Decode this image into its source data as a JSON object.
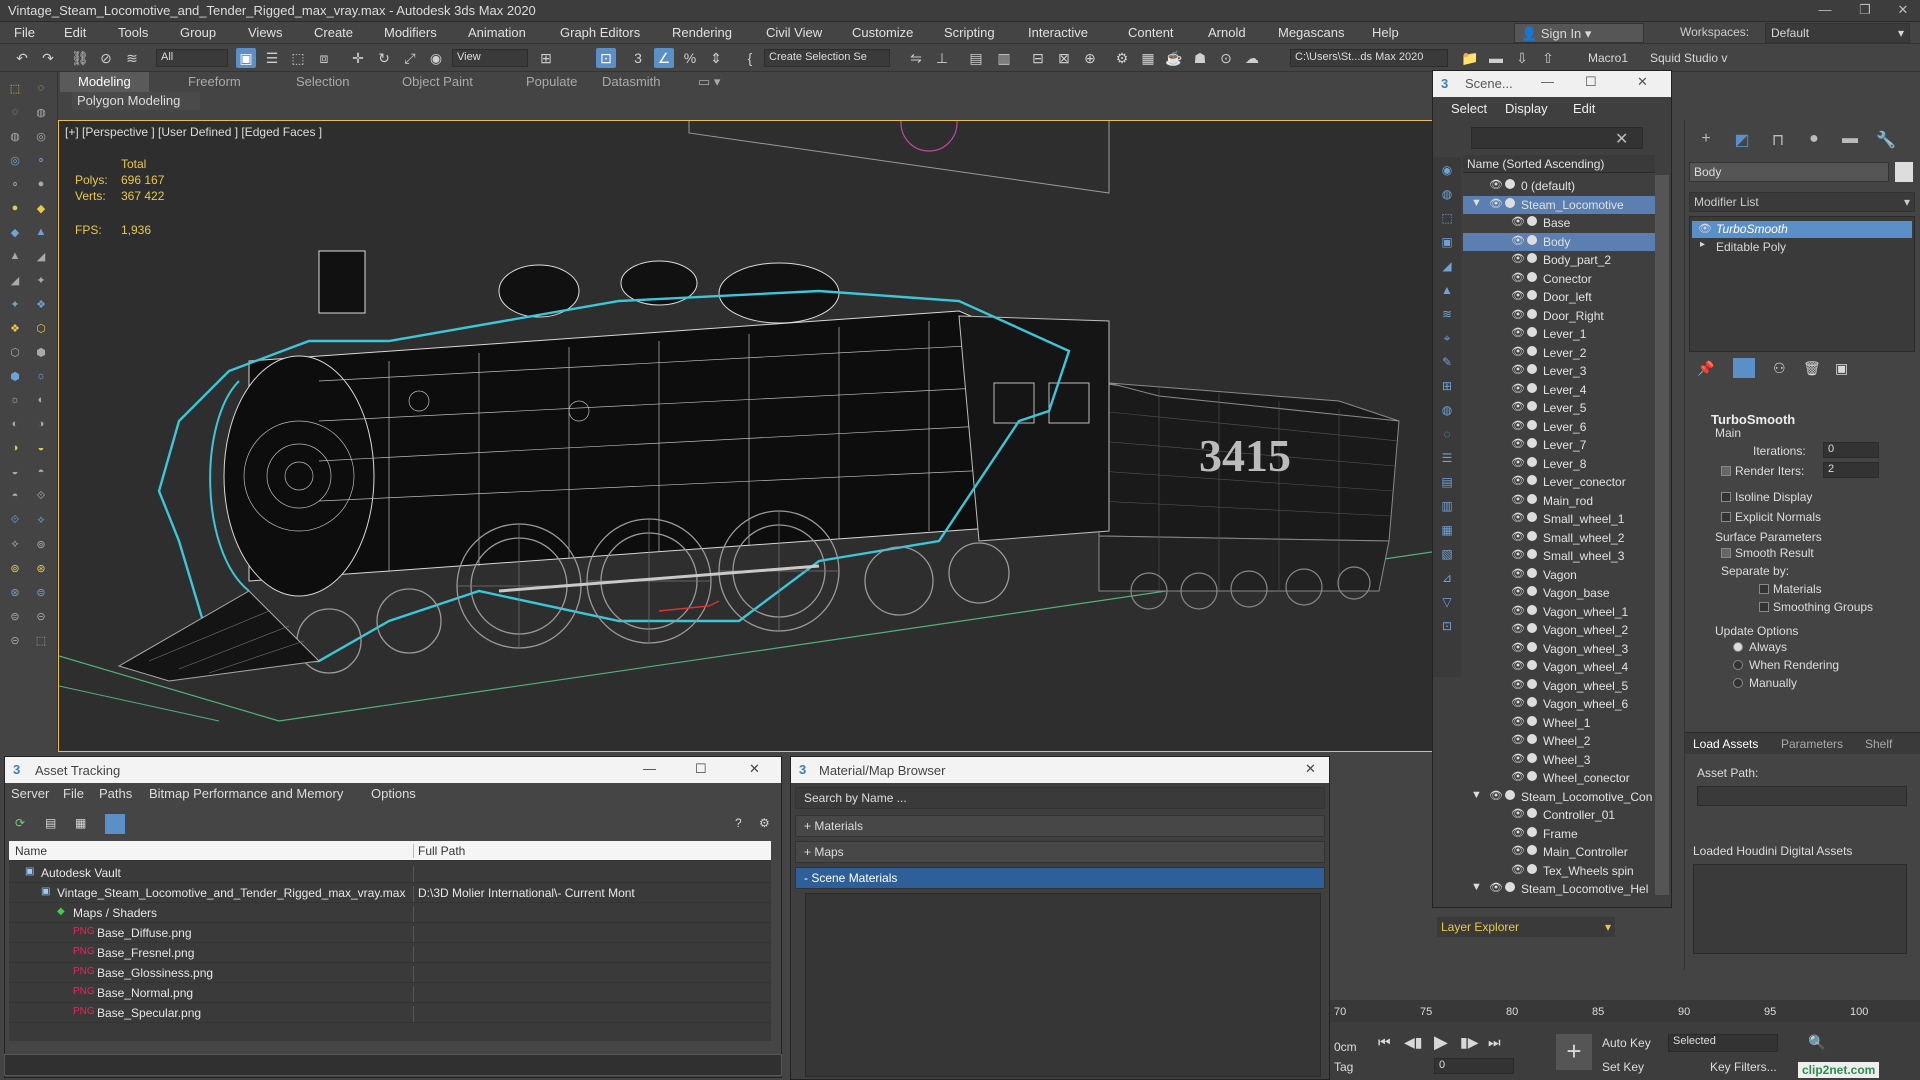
{
  "window": {
    "title": "Vintage_Steam_Locomotive_and_Tender_Rigged_max_vray.max - Autodesk 3ds Max 2020"
  },
  "menubar": [
    "File",
    "Edit",
    "Tools",
    "Group",
    "Views",
    "Create",
    "Modifiers",
    "Animation",
    "Graph Editors",
    "Rendering",
    "Civil View",
    "Customize",
    "Scripting",
    "Interactive",
    "Content",
    "Arnold",
    "Megascans",
    "Help"
  ],
  "account": {
    "signin": "Sign In",
    "workspaces_label": "Workspaces:",
    "workspace": "Default"
  },
  "toolbar": {
    "filter": "All",
    "refcoord": "View",
    "create_selection": "Create Selection Se",
    "path": "C:\\Users\\St...ds Max 2020",
    "macro": "Macro1",
    "studio": "Squid Studio v"
  },
  "ribbon": {
    "tabs": [
      "Modeling",
      "Freeform",
      "Selection",
      "Object Paint",
      "Populate",
      "Datasmith"
    ],
    "active": "Modeling",
    "sub": "Polygon Modeling"
  },
  "viewport": {
    "label": "[+] [Perspective ] [User Defined ] [Edged Faces ]",
    "stats_total": "Total",
    "polys_label": "Polys:",
    "polys": "696 167",
    "verts_label": "Verts:",
    "verts": "367 422",
    "fps_label": "FPS:",
    "fps": "1,936",
    "tender_number": "3415"
  },
  "scene_explorer": {
    "title": "Scene...",
    "menus": [
      "Select",
      "Display",
      "Edit"
    ],
    "column": "Name (Sorted Ascending)",
    "items": [
      {
        "name": "0 (default)",
        "level": 0
      },
      {
        "name": "Steam_Locomotive",
        "level": 0
      },
      {
        "name": "Base",
        "level": 1
      },
      {
        "name": "Body",
        "level": 1
      },
      {
        "name": "Body_part_2",
        "level": 1
      },
      {
        "name": "Conector",
        "level": 1
      },
      {
        "name": "Door_left",
        "level": 1
      },
      {
        "name": "Door_Right",
        "level": 1
      },
      {
        "name": "Lever_1",
        "level": 1
      },
      {
        "name": "Lever_2",
        "level": 1
      },
      {
        "name": "Lever_3",
        "level": 1
      },
      {
        "name": "Lever_4",
        "level": 1
      },
      {
        "name": "Lever_5",
        "level": 1
      },
      {
        "name": "Lever_6",
        "level": 1
      },
      {
        "name": "Lever_7",
        "level": 1
      },
      {
        "name": "Lever_8",
        "level": 1
      },
      {
        "name": "Lever_conector",
        "level": 1
      },
      {
        "name": "Main_rod",
        "level": 1
      },
      {
        "name": "Small_wheel_1",
        "level": 1
      },
      {
        "name": "Small_wheel_2",
        "level": 1
      },
      {
        "name": "Small_wheel_3",
        "level": 1
      },
      {
        "name": "Vagon",
        "level": 1
      },
      {
        "name": "Vagon_base",
        "level": 1
      },
      {
        "name": "Vagon_wheel_1",
        "level": 1
      },
      {
        "name": "Vagon_wheel_2",
        "level": 1
      },
      {
        "name": "Vagon_wheel_3",
        "level": 1
      },
      {
        "name": "Vagon_wheel_4",
        "level": 1
      },
      {
        "name": "Vagon_wheel_5",
        "level": 1
      },
      {
        "name": "Vagon_wheel_6",
        "level": 1
      },
      {
        "name": "Wheel_1",
        "level": 1
      },
      {
        "name": "Wheel_2",
        "level": 1
      },
      {
        "name": "Wheel_3",
        "level": 1
      },
      {
        "name": "Wheel_conector",
        "level": 1
      },
      {
        "name": "Steam_Locomotive_Con",
        "level": 0
      },
      {
        "name": "Controller_01",
        "level": 1
      },
      {
        "name": "Frame",
        "level": 1
      },
      {
        "name": "Main_Controller",
        "level": 1
      },
      {
        "name": "Tex_Wheels spin",
        "level": 1
      },
      {
        "name": "Steam_Locomotive_Hel",
        "level": 0
      }
    ],
    "layer_explorer": "Layer Explorer"
  },
  "command_panel": {
    "object_name": "Body",
    "modifier_list": "Modifier List",
    "stack": [
      "TurboSmooth",
      "Editable Poly"
    ],
    "rollout": "TurboSmooth",
    "main": "Main",
    "iterations_label": "Iterations:",
    "iterations": "0",
    "render_iters_label": "Render Iters:",
    "render_iters": "2",
    "isoline": "Isoline Display",
    "explicit": "Explicit Normals",
    "surface": "Surface Parameters",
    "smooth_result": "Smooth Result",
    "separate_by": "Separate by:",
    "materials": "Materials",
    "smoothing_groups": "Smoothing Groups",
    "update_options": "Update Options",
    "always": "Always",
    "when_rendering": "When Rendering",
    "manually": "Manually",
    "tabs": [
      "Load Assets",
      "Parameters",
      "Shelf"
    ],
    "asset_path": "Asset Path:",
    "loaded_houdini": "Loaded Houdini Digital Assets"
  },
  "asset_tracking": {
    "title": "Asset Tracking",
    "menus": [
      "Server",
      "File",
      "Paths",
      "Bitmap Performance and Memory",
      "Options"
    ],
    "col_name": "Name",
    "col_path": "Full Path",
    "rows": [
      {
        "name": "Autodesk Vault",
        "path": "",
        "indent": 1
      },
      {
        "name": "Vintage_Steam_Locomotive_and_Tender_Rigged_max_vray.max",
        "path": "D:\\3D Molier International\\- Current Mont",
        "indent": 2
      },
      {
        "name": "Maps / Shaders",
        "path": "",
        "indent": 3
      },
      {
        "name": "Base_Diffuse.png",
        "path": "",
        "indent": 4
      },
      {
        "name": "Base_Fresnel.png",
        "path": "",
        "indent": 4
      },
      {
        "name": "Base_Glossiness.png",
        "path": "",
        "indent": 4
      },
      {
        "name": "Base_Normal.png",
        "path": "",
        "indent": 4
      },
      {
        "name": "Base_Specular.png",
        "path": "",
        "indent": 4
      }
    ]
  },
  "material_browser": {
    "title": "Material/Map Browser",
    "search": "Search by Name ...",
    "sections": [
      "+ Materials",
      "+ Maps",
      "- Scene Materials"
    ]
  },
  "timeline": {
    "ticks": [
      "70",
      "75",
      "80",
      "85",
      "90",
      "95",
      "100"
    ],
    "units": "0cm",
    "tag": "Tag",
    "autokey": "Auto Key",
    "setkey": "Set Key",
    "selected": "Selected",
    "keyfilters": "Key Filters...",
    "frame": "0"
  },
  "watermark": "clip2net.com"
}
